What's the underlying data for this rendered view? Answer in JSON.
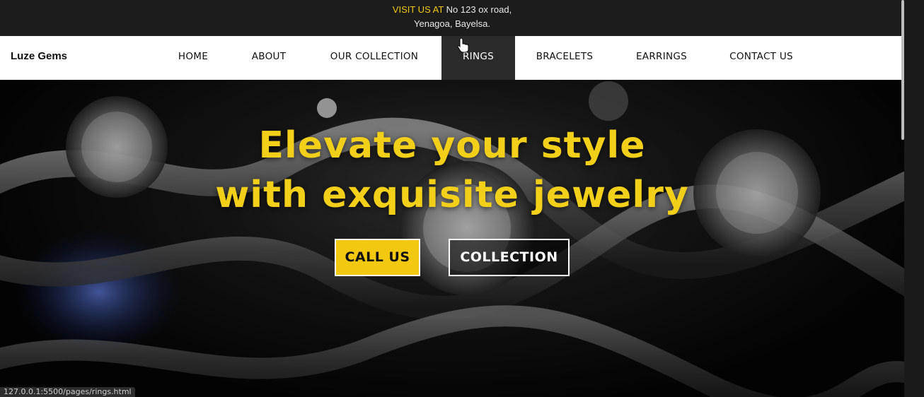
{
  "topbar": {
    "visit_label": "VISIT US AT",
    "address_line1": "No 123 ox road,",
    "address_line2": "Yenagoa, Bayelsa."
  },
  "brand": {
    "name": "Luze Gems"
  },
  "nav": {
    "items": [
      {
        "label": "HOME"
      },
      {
        "label": "ABOUT"
      },
      {
        "label": "OUR COLLECTION"
      },
      {
        "label": "RINGS",
        "active": true
      },
      {
        "label": "BRACELETS"
      },
      {
        "label": "EARRINGS"
      },
      {
        "label": "CONTACT US"
      }
    ]
  },
  "hero": {
    "title_line1": "Elevate your style",
    "title_line2": "with exquisite jewelry",
    "call_button": "CALL US",
    "collection_button": "COLLECTION"
  },
  "status": {
    "url": "127.0.0.1:5500/pages/rings.html"
  },
  "colors": {
    "accent": "#f2c811",
    "topbar": "#1c1c1c",
    "active_nav": "#2b2b2b"
  }
}
